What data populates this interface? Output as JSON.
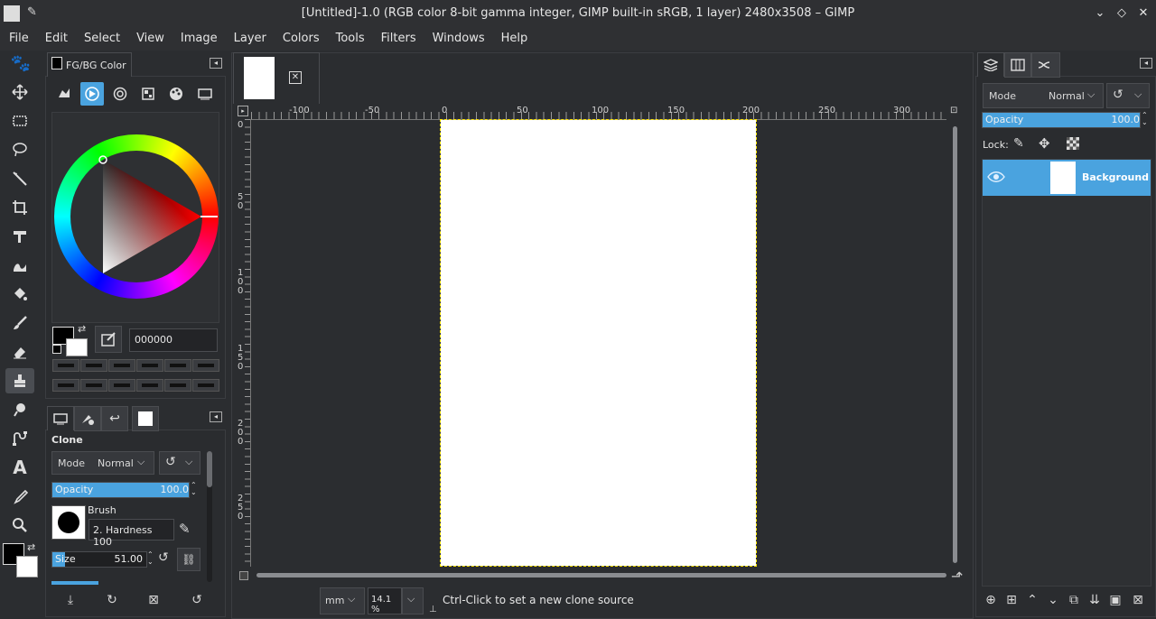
{
  "window": {
    "title": "[Untitled]-1.0 (RGB color 8-bit gamma integer, GIMP built-in sRGB, 1 layer) 2480x3508 – GIMP"
  },
  "menubar": [
    "File",
    "Edit",
    "Select",
    "View",
    "Image",
    "Layer",
    "Colors",
    "Tools",
    "Filters",
    "Windows",
    "Help"
  ],
  "colors": {
    "accent": "#4aa3df",
    "bg": "#2b2d30",
    "panel": "#2a2c2f",
    "canvas": "#ffffff"
  },
  "fg_bg_panel": {
    "tab_label": "FG/BG Color",
    "hex_value": "000000"
  },
  "tool_options": {
    "title": "Clone",
    "mode_label": "Mode",
    "mode_value": "Normal",
    "opacity_label": "Opacity",
    "opacity_value": "100.0",
    "opacity_fraction": 1.0,
    "brush_label": "Brush",
    "brush_name": "2. Hardness 100",
    "size_label": "Size",
    "size_value": "51.00",
    "size_fraction": 0.1
  },
  "image_window": {
    "ruler_top": [
      "-100",
      "-50",
      "0",
      "50",
      "100",
      "150",
      "200",
      "250",
      "300"
    ],
    "ruler_left": [
      "0",
      "50",
      "100",
      "150",
      "200",
      "250"
    ],
    "unit": "mm",
    "zoom": "14.1 %",
    "status": "Ctrl-Click to set a new clone source"
  },
  "layers_panel": {
    "mode_label": "Mode",
    "mode_value": "Normal",
    "opacity_label": "Opacity",
    "opacity_value": "100.0",
    "opacity_fraction": 1.0,
    "lock_label": "Lock:",
    "layers": [
      {
        "name": "Background",
        "visible": true
      }
    ]
  }
}
